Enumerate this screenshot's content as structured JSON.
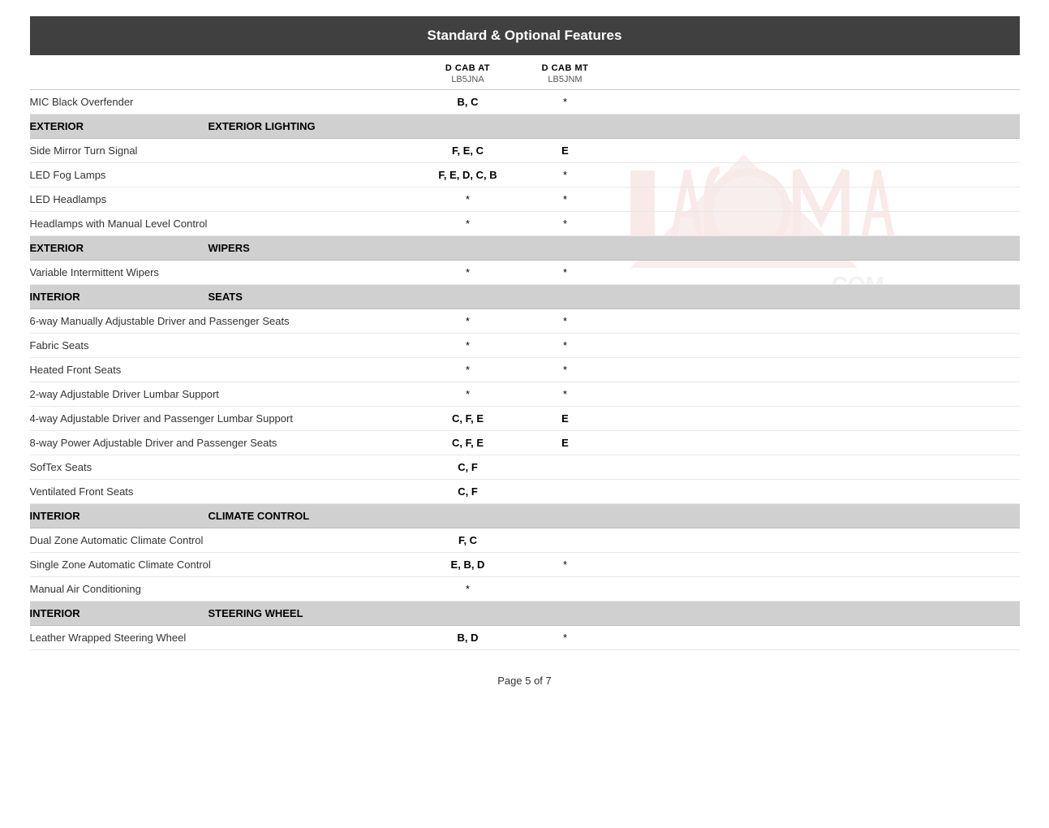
{
  "page": {
    "title": "Standard & Optional Features",
    "footer": "Page 5 of 7"
  },
  "columns": {
    "dcabat": {
      "label": "D CAB AT",
      "code": "LB5JNA"
    },
    "dcabmt": {
      "label": "D CAB MT",
      "code": "LB5JNM"
    }
  },
  "sections": [
    {
      "category": "",
      "subcategory": "",
      "is_header": false,
      "features": [
        {
          "name": "MIC Black Overfender",
          "dcabat": "B, C",
          "dcabmt": "*"
        }
      ]
    },
    {
      "category": "EXTERIOR",
      "subcategory": "EXTERIOR LIGHTING",
      "is_header": true,
      "features": [
        {
          "name": "Side Mirror Turn Signal",
          "dcabat": "F, E, C",
          "dcabmt": "E"
        },
        {
          "name": "LED Fog Lamps",
          "dcabat": "F, E, D, C, B",
          "dcabmt": "*"
        },
        {
          "name": "LED Headlamps",
          "dcabat": "*",
          "dcabmt": "*"
        },
        {
          "name": "Headlamps with Manual Level Control",
          "dcabat": "*",
          "dcabmt": "*"
        }
      ]
    },
    {
      "category": "EXTERIOR",
      "subcategory": "WIPERS",
      "is_header": true,
      "features": [
        {
          "name": "Variable Intermittent Wipers",
          "dcabat": "*",
          "dcabmt": "*"
        }
      ]
    },
    {
      "category": "INTERIOR",
      "subcategory": "SEATS",
      "is_header": true,
      "features": [
        {
          "name": "6-way Manually Adjustable Driver and Passenger Seats",
          "dcabat": "*",
          "dcabmt": "*"
        },
        {
          "name": "Fabric Seats",
          "dcabat": "*",
          "dcabmt": "*"
        },
        {
          "name": "Heated Front Seats",
          "dcabat": "*",
          "dcabmt": "*"
        },
        {
          "name": "2-way Adjustable Driver Lumbar Support",
          "dcabat": "*",
          "dcabmt": "*"
        },
        {
          "name": "4-way Adjustable Driver and Passenger Lumbar Support",
          "dcabat": "C, F, E",
          "dcabmt": "E"
        },
        {
          "name": "8-way Power Adjustable Driver and Passenger Seats",
          "dcabat": "C, F, E",
          "dcabmt": "E"
        },
        {
          "name": "SofTex Seats",
          "dcabat": "C, F",
          "dcabmt": ""
        },
        {
          "name": "Ventilated Front Seats",
          "dcabat": "C, F",
          "dcabmt": ""
        }
      ]
    },
    {
      "category": "INTERIOR",
      "subcategory": "CLIMATE CONTROL",
      "is_header": true,
      "features": [
        {
          "name": "Dual Zone Automatic Climate Control",
          "dcabat": "F, C",
          "dcabmt": ""
        },
        {
          "name": "Single Zone Automatic Climate Control",
          "dcabat": "E, B, D",
          "dcabmt": "*"
        },
        {
          "name": "Manual Air Conditioning",
          "dcabat": "*",
          "dcabmt": ""
        }
      ]
    },
    {
      "category": "INTERIOR",
      "subcategory": "STEERING WHEEL",
      "is_header": true,
      "features": [
        {
          "name": "Leather Wrapped Steering Wheel",
          "dcabat": "B, D",
          "dcabmt": "*"
        }
      ]
    }
  ]
}
